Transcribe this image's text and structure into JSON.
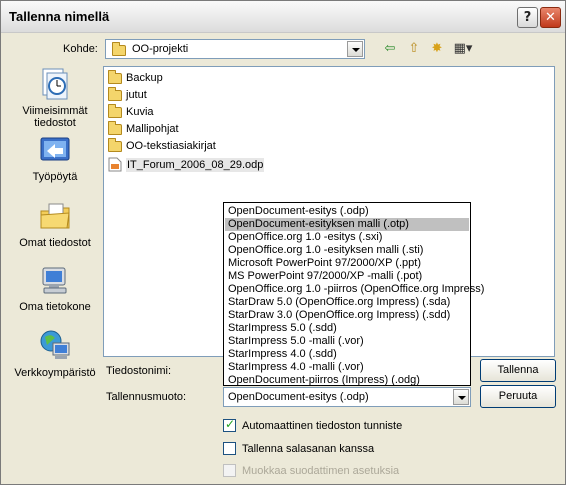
{
  "window": {
    "title": "Tallenna nimellä",
    "help": "?",
    "close": "✕"
  },
  "location": {
    "label": "Kohde:",
    "value": "OO-projekti"
  },
  "toolbar": {
    "back_icon": "⇦",
    "up_icon": "⇧",
    "new_folder_icon": "✸",
    "views_icon": "▦▾"
  },
  "places": [
    {
      "label": "Viimeisimmät tiedostot",
      "icon": "recent-documents-icon"
    },
    {
      "label": "Työpöytä",
      "icon": "desktop-icon"
    },
    {
      "label": "Omat tiedostot",
      "icon": "my-documents-icon"
    },
    {
      "label": "Oma tietokone",
      "icon": "my-computer-icon"
    },
    {
      "label": "Verkkoympäristö",
      "icon": "network-places-icon"
    }
  ],
  "files": [
    {
      "name": "Backup",
      "type": "folder"
    },
    {
      "name": "jutut",
      "type": "folder"
    },
    {
      "name": "Kuvia",
      "type": "folder"
    },
    {
      "name": "Mallipohjat",
      "type": "folder"
    },
    {
      "name": "OO-tekstiasiakirjat",
      "type": "folder"
    },
    {
      "name": "IT_Forum_2006_08_29.odp",
      "type": "file"
    }
  ],
  "filename": {
    "label": "Tiedostonimi:",
    "value": ""
  },
  "filetype": {
    "label": "Tallennusmuoto:",
    "value": "OpenDocument-esitys (.odp)",
    "options": [
      "OpenDocument-esitys (.odp)",
      "OpenDocument-esityksen malli (.otp)",
      "OpenOffice.org 1.0 -esitys (.sxi)",
      "OpenOffice.org 1.0 -esityksen malli (.sti)",
      "Microsoft PowerPoint 97/2000/XP (.ppt)",
      "MS PowerPoint 97/2000/XP -malli (.pot)",
      "OpenOffice.org 1.0 -piirros (OpenOffice.org Impress)",
      "StarDraw 5.0 (OpenOffice.org Impress) (.sda)",
      "StarDraw 3.0 (OpenOffice.org Impress) (.sdd)",
      "StarImpress 5.0 (.sdd)",
      "StarImpress 5.0 -malli (.vor)",
      "StarImpress 4.0 (.sdd)",
      "StarImpress 4.0 -malli (.vor)",
      "OpenDocument-piirros (Impress) (.odg)"
    ],
    "highlighted_index": 1
  },
  "buttons": {
    "save": "Tallenna",
    "cancel": "Peruuta"
  },
  "options": {
    "auto_extension": {
      "label": "Automaattinen tiedoston tunniste",
      "checked": true
    },
    "password": {
      "label": "Tallenna salasanan kanssa",
      "checked": false
    },
    "filter_settings": {
      "label": "Muokkaa suodattimen asetuksia",
      "checked": false,
      "disabled": true
    }
  },
  "colors": {
    "selection": "#c0c0c0",
    "field_border": "#7f9db9",
    "dialog_bg": "#ece9d8"
  }
}
